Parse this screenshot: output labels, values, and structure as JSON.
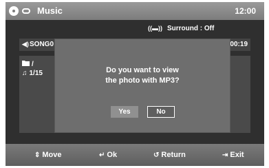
{
  "titlebar": {
    "title": "Music",
    "clock": "12:00",
    "disc_icon": "disc-icon",
    "link_icon": "anynet-link-icon"
  },
  "surround": {
    "icon_text": "((▬))",
    "text": "Surround : Off"
  },
  "song": {
    "icon_text": "◀)",
    "label": "SONG0",
    "time": "0:00:19"
  },
  "browser": {
    "folder_icon": "folder-icon",
    "path": "/",
    "note_icon": "music-note-icon",
    "track": "1/15"
  },
  "dialog": {
    "line1": "Do you want to view",
    "line2": "the photo with MP3?",
    "yes_label": "Yes",
    "no_label": "No",
    "selected": "No"
  },
  "bottombar": {
    "move": {
      "key": "⇕",
      "label": "Move"
    },
    "ok": {
      "key": "↵",
      "label": "Ok"
    },
    "return": {
      "key": "↺",
      "label": "Return"
    },
    "exit": {
      "key": "⇥",
      "label": "Exit"
    }
  },
  "colors": {
    "background": "#2f2f2f",
    "panel": "#4a4a4a",
    "dialog": "#6e6e6e",
    "bar": "#7a7a7a"
  }
}
